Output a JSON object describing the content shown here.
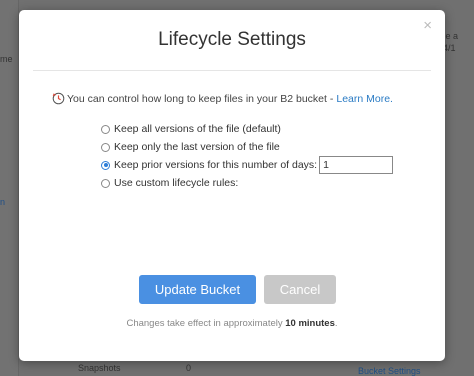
{
  "background": {
    "fragments": [
      "me",
      "n",
      "me a",
      "14/1",
      "Snapshots",
      "0",
      "Bucket Settings"
    ]
  },
  "modal": {
    "title": "Lifecycle Settings",
    "close_symbol": "×",
    "intro_text": "You can control how long to keep files in your B2 bucket - ",
    "learn_more": "Learn More.",
    "options": [
      {
        "label": "Keep all versions of the file (default)",
        "checked": false
      },
      {
        "label": "Keep only the last version of the file",
        "checked": false
      },
      {
        "label": "Keep prior versions for this number of days:",
        "checked": true
      },
      {
        "label": "Use custom lifecycle rules:",
        "checked": false
      }
    ],
    "days_value": "1",
    "update_label": "Update Bucket",
    "cancel_label": "Cancel",
    "footnote_prefix": "Changes take effect in approximately ",
    "footnote_bold": "10 minutes",
    "footnote_suffix": ".",
    "colors": {
      "primary": "#4a90e2",
      "disabled": "#c8c8c8",
      "link": "#2a7bc4"
    }
  }
}
